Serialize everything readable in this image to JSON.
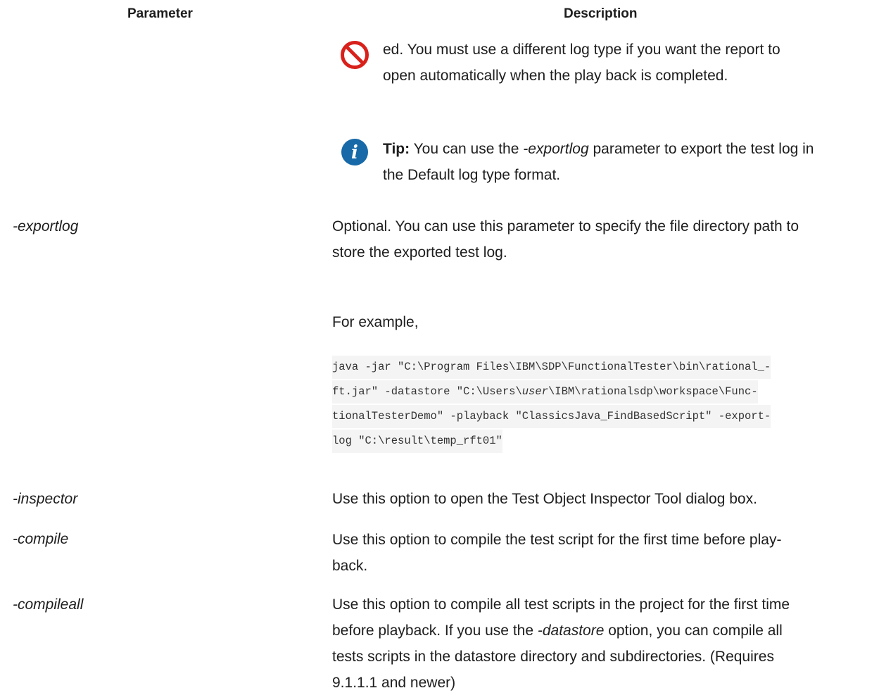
{
  "table": {
    "headers": {
      "parameter": "Parameter",
      "description": "Description"
    },
    "note": {
      "icon": "prohibited-icon",
      "line1": "ed. You must use a different log type if you want the report to",
      "line2": "open automatically when the play back is completed."
    },
    "tip": {
      "icon": "info-icon",
      "label": "Tip:",
      "pre": " You can use the ",
      "param": "-exportlog",
      "post1": " parameter to export the test log in",
      "line2": "the Default log type format."
    },
    "rows": [
      {
        "name": "-exportlog",
        "desc_line1": "Optional. You can use this parameter to specify the file directory path to",
        "desc_line2": "store the exported test log.",
        "example_label": "For example,",
        "code_line1": "java -jar \"C:\\Program Files\\IBM\\SDP\\FunctionalTester\\bin\\rational_-",
        "code_line2a": "ft.jar\" -datastore \"C:\\Users\\",
        "code_line2_user": "user",
        "code_line2b": "\\IBM\\rationalsdp\\workspace\\Func-",
        "code_line3": "tionalTesterDemo\" -playback \"ClassicsJava_FindBasedScript\" -export-",
        "code_line4": "log \"C:\\result\\temp_rft01\""
      },
      {
        "name": "-inspector",
        "desc_line1": "Use this option to open the Test Object Inspector Tool dialog box."
      },
      {
        "name": "-compile",
        "desc_line1": "Use this option to compile the test script for the first time before play-",
        "desc_line2": "back."
      },
      {
        "name": "-compileall",
        "desc_line1": "Use this option to compile all test scripts in the project for the first time",
        "desc_line2_pre": "before playback. If you use the ",
        "desc_line2_param": "-datastore",
        "desc_line2_post": " option, you can compile all",
        "desc_line3": "tests scripts in the datastore directory and subdirectories. (Requires",
        "desc_line4": "9.1.1.1 and newer)"
      }
    ]
  },
  "colors": {
    "prohibited": "#d9211b",
    "info": "#1769a8"
  }
}
